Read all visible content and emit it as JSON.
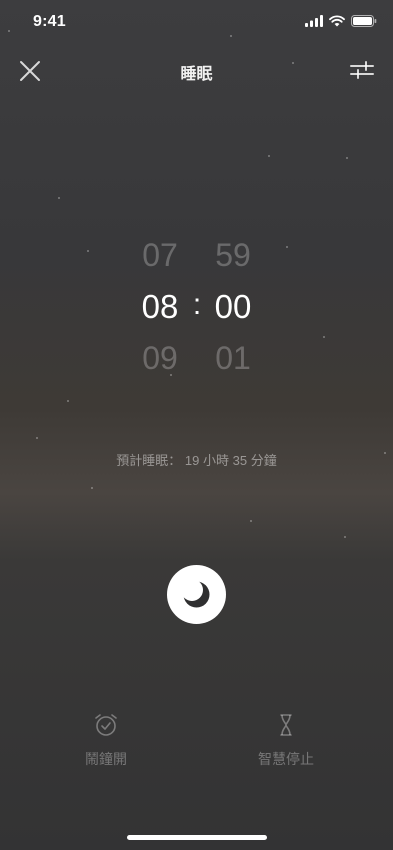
{
  "status_bar": {
    "time": "9:41"
  },
  "header": {
    "title": "睡眠",
    "close_icon": "close-icon",
    "settings_icon": "sliders-icon"
  },
  "time_picker": {
    "hours": [
      "07",
      "08",
      "09"
    ],
    "minutes": [
      "59",
      "00",
      "01"
    ],
    "separator": ":",
    "selected_hour": "08",
    "selected_minute": "00"
  },
  "estimate": {
    "label": "預計睡眠：",
    "hours": "19",
    "hours_unit": "小時",
    "minutes": "35",
    "minutes_unit": "分鐘"
  },
  "main_button": {
    "icon": "moon-icon"
  },
  "bottom_bar": {
    "alarm": {
      "label": "鬧鐘開",
      "icon": "alarm-clock-icon"
    },
    "smart_stop": {
      "label": "智慧停止",
      "icon": "hourglass-icon"
    }
  },
  "colors": {
    "background": "#3a3a3b",
    "button": "#ffffff",
    "text_dim": "#8a8a8a"
  }
}
